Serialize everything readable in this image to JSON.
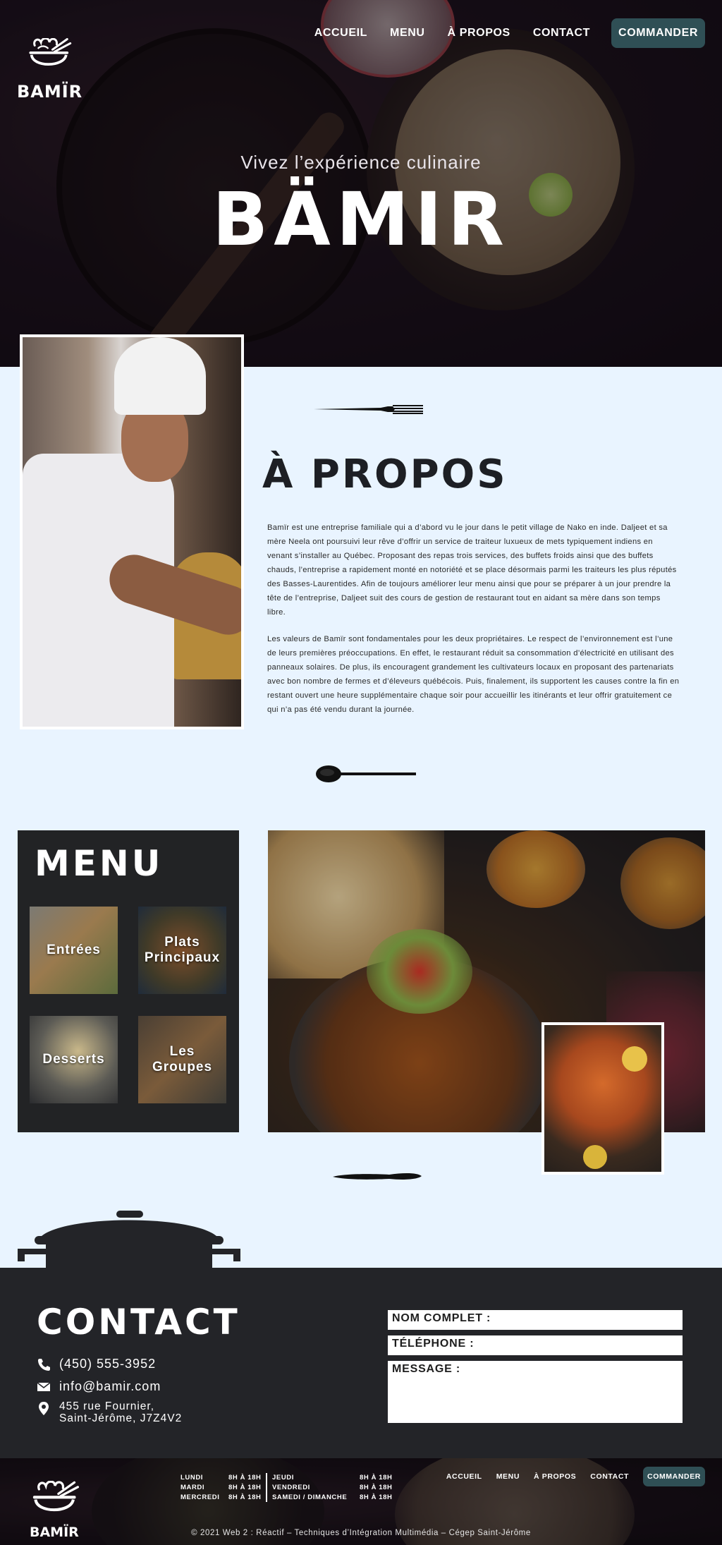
{
  "brand": {
    "logo_text": "BAMÏR",
    "tagline": "Vivez l’expérience culinaire",
    "name": "BÄMIR"
  },
  "nav": {
    "items": [
      "ACCUEIL",
      "MENU",
      "À PROPOS",
      "CONTACT"
    ],
    "cta": "COMMANDER"
  },
  "about": {
    "title": "À PROPOS",
    "paragraphs": [
      "Bamïr est une entreprise familiale qui a d’abord vu le jour dans le petit village de Nako en inde. Daljeet et sa mère Neela ont poursuivi leur rêve d’offrir un service de traiteur luxueux de mets typiquement indiens en venant s’installer au Québec. Proposant des repas trois services, des buffets froids ainsi que des buffets chauds, l’entreprise a rapidement monté en notoriété et se place désormais parmi les traiteurs les plus réputés des Basses-Laurentides. Afin de toujours améliorer leur menu ainsi que pour se préparer à un jour prendre la tête de l’entreprise, Daljeet suit des cours de gestion de restaurant tout en aidant sa mère dans son temps libre.",
      "Les valeurs de Bamïr sont fondamentales pour les deux propriétaires. Le respect de l’environnement est l’une de leurs premières préoccupations. En effet, le restaurant réduit sa consommation d’électricité en utilisant des panneaux solaires. De plus, ils encouragent grandement les cultivateurs locaux en proposant des partenariats avec bon nombre de fermes et d’éleveurs québécois. Puis, finalement, ils supportent les causes contre la fin en restant ouvert une heure supplémentaire chaque soir pour accueillir les itinérants et leur offrir gratuitement ce qui n’a pas été vendu durant la journée."
    ]
  },
  "menu": {
    "title": "MENU",
    "categories": [
      "Entrées",
      "Plats Principaux",
      "Desserts",
      "Les Groupes"
    ]
  },
  "contact": {
    "title": "CONTACT",
    "phone": "(450) 555-3952",
    "email": "info@bamir.com",
    "address_line1": "455 rue Fournier,",
    "address_line2": "Saint-Jérôme, J7Z4V2",
    "form": {
      "name_label": "NOM COMPLET :",
      "phone_label": "TÉLÉPHONE :",
      "message_label": "MESSAGE :"
    }
  },
  "footer": {
    "logo_text": "BAMÏR",
    "hours": [
      {
        "day": "LUNDI",
        "time": "8H À 18H"
      },
      {
        "day": "MARDI",
        "time": "8H À 18H"
      },
      {
        "day": "MERCREDI",
        "time": "8H À 18H"
      },
      {
        "day": "JEUDI",
        "time": "8H À 18H"
      },
      {
        "day": "VENDREDI",
        "time": "8H À 18H"
      },
      {
        "day": "SAMEDI / DIMANCHE",
        "time": "8H À 18H"
      }
    ],
    "copyright": "© 2021 Web 2 : Réactif – Techniques d’Intégration Multimédia – Cégep Saint-Jérôme"
  },
  "colors": {
    "page_bg": "#e9f4ff",
    "dark": "#232428",
    "cta": "#2f4f55"
  }
}
